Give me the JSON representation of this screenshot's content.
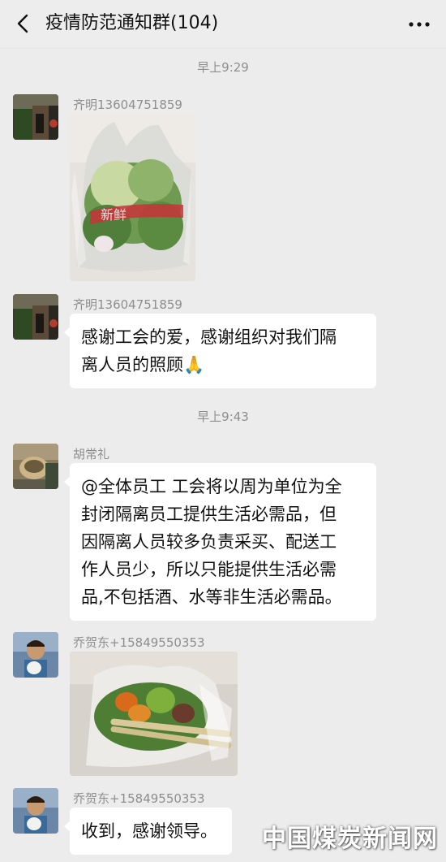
{
  "header": {
    "title": "疫情防范通知群(104)",
    "back_icon": "chevron-left-icon",
    "more_icon": "more-dots-icon"
  },
  "messages": {
    "ts1": "早上9:29",
    "m1_sender": "齐明13604751859",
    "m2_sender": "齐明13604751859",
    "m2_lines": [
      "感谢工会的爱，感谢组织对我们隔",
      "离人员的照顾🙏"
    ],
    "ts2": "早上9:43",
    "m3_sender": "胡常礼",
    "m3_lines": [
      "@全体员工  工会将以周为单位为全",
      "封闭隔离员工提供生活必需品，但",
      "因隔离人员较多负责采买、配送工",
      "作人员少，所以只能提供生活必需",
      "品,不包括酒、水等非生活必需品。"
    ],
    "m4_sender": "乔贺东+15849550353",
    "m5_sender": "乔贺东+15849550353",
    "m5_text": "收到，感谢领导。"
  },
  "watermark": "中国煤炭新闻网",
  "colors": {
    "background": "#ececec",
    "bubble": "#ffffff",
    "meta_text": "#8e8e8e"
  }
}
